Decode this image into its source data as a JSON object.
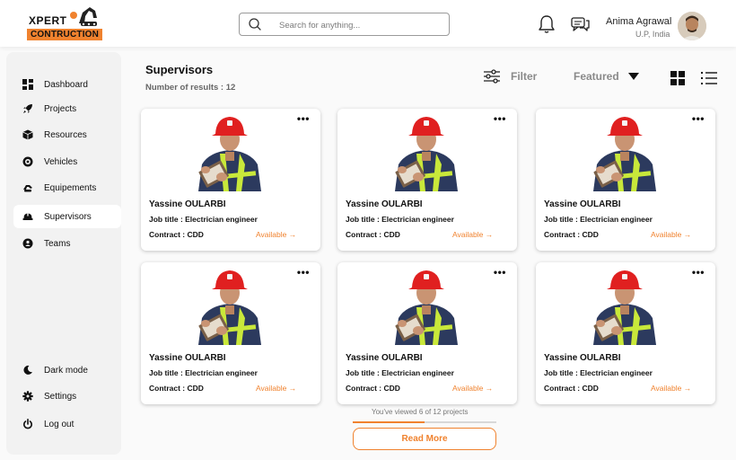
{
  "header": {
    "logo_top": "XPERT",
    "logo_bottom": "CONTRUCTION",
    "search_placeholder": "Search for anything...",
    "user_name": "Anima Agrawal",
    "user_location": "U.P, India"
  },
  "sidebar": {
    "top_items": [
      {
        "label": "Dashboard",
        "icon": "dashboard-icon"
      },
      {
        "label": "Projects",
        "icon": "rocket-icon"
      },
      {
        "label": "Resources",
        "icon": "box-icon"
      },
      {
        "label": "Vehicles",
        "icon": "vehicle-icon"
      },
      {
        "label": "Equipements",
        "icon": "equipment-icon"
      },
      {
        "label": "Supervisors",
        "icon": "helmet-icon",
        "active": true
      },
      {
        "label": "Teams",
        "icon": "team-icon"
      }
    ],
    "bottom_items": [
      {
        "label": "Dark mode",
        "icon": "moon-icon"
      },
      {
        "label": "Settings",
        "icon": "gear-icon"
      },
      {
        "label": "Log out",
        "icon": "power-icon"
      }
    ]
  },
  "main": {
    "title": "Supervisors",
    "results_label": "Number of results : 12",
    "filter_label": "Filter",
    "sort_label": "Featured",
    "cards": [
      {
        "name": "Yassine OULARBI",
        "job": "Job title : Electrician engineer",
        "contract": "Contract :  CDD",
        "status": "Available →"
      },
      {
        "name": "Yassine OULARBI",
        "job": "Job title : Electrician engineer",
        "contract": "Contract :  CDD",
        "status": "Available →"
      },
      {
        "name": "Yassine OULARBI",
        "job": "Job title : Electrician engineer",
        "contract": "Contract :  CDD",
        "status": "Available →"
      },
      {
        "name": "Yassine OULARBI",
        "job": "Job title : Electrician engineer",
        "contract": "Contract :  CDD",
        "status": "Available →"
      },
      {
        "name": "Yassine OULARBI",
        "job": "Job title : Electrician engineer",
        "contract": "Contract :  CDD",
        "status": "Available →"
      },
      {
        "name": "Yassine OULARBI",
        "job": "Job title : Electrician engineer",
        "contract": "Contract :  CDD",
        "status": "Available →"
      }
    ],
    "viewed_text": "You've viewed 6 of 12 projects",
    "viewed_fraction": 0.5,
    "read_more_label": "Read More"
  },
  "colors": {
    "accent": "#f0822e",
    "helmet": "#e02020",
    "jacket": "#2c3a5e",
    "vest_stripe": "#c9e83a"
  }
}
